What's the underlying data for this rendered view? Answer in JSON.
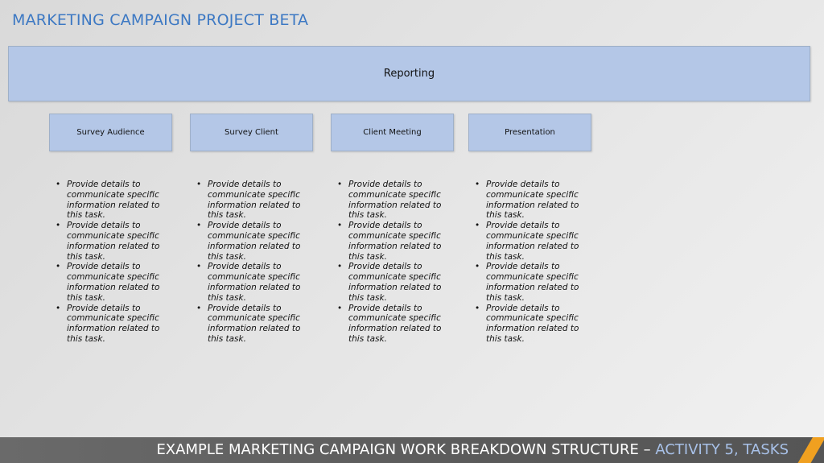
{
  "title": "MARKETING CAMPAIGN PROJECT BETA",
  "root": {
    "label": "Reporting"
  },
  "tasks": [
    {
      "label": "Survey Audience",
      "bullets": [
        "Provide details to communicate specific information related to this task.",
        "Provide details to communicate specific information related to this task.",
        "Provide details to communicate specific information related to this task.",
        "Provide details to communicate specific information related to this task."
      ]
    },
    {
      "label": "Survey Client",
      "bullets": [
        "Provide details to communicate specific information related to this task.",
        "Provide details to communicate specific information related to this task.",
        "Provide details to communicate specific information related to this task.",
        "Provide details to communicate specific information related to this task."
      ]
    },
    {
      "label": "Client Meeting",
      "bullets": [
        "Provide details to communicate specific information related to this task.",
        "Provide details to communicate specific information related to this task.",
        "Provide details to communicate specific information related to this task.",
        "Provide details to communicate specific information related to this task."
      ]
    },
    {
      "label": "Presentation",
      "bullets": [
        "Provide details to communicate specific information related to this task.",
        "Provide details to communicate specific information related to this task.",
        "Provide details to communicate specific information related to this task.",
        "Provide details to communicate specific information related to this task."
      ]
    }
  ],
  "footer": {
    "main": "EXAMPLE MARKETING CAMPAIGN WORK BREAKDOWN STRUCTURE – ",
    "accent": "ACTIVITY 5, TASKS"
  },
  "colors": {
    "title": "#3c78c3",
    "box_fill": "#b4c7e7",
    "footer_bg": "#5a5a5a",
    "footer_accent": "#a8c1e8",
    "stripe": "#f0a020"
  }
}
